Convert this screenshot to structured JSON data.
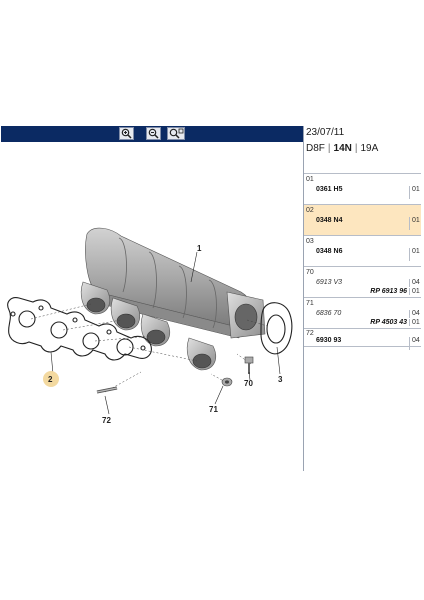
{
  "toolbar": {
    "buttons": [
      {
        "label": "zoom in",
        "icon": "zoom-in-icon"
      },
      {
        "label": "zoom out",
        "icon": "zoom-out-icon"
      },
      {
        "label": "fit",
        "icon": "zoom-fit-icon"
      }
    ]
  },
  "header": {
    "date": "23/07/11",
    "code1": "D8F",
    "code2": "14N",
    "code3": "19A"
  },
  "parts": [
    {
      "index": "01",
      "ref": "0361 H5",
      "qty": "01",
      "selected": false,
      "italic": false
    },
    {
      "index": "02",
      "ref": "0348 N4",
      "qty": "01",
      "selected": true,
      "italic": false
    },
    {
      "index": "03",
      "ref": "0348 N6",
      "qty": "01",
      "selected": false,
      "italic": false
    },
    {
      "index": "70",
      "ref": "6913 V3",
      "replacement": "RP 6913 96",
      "qty": "04",
      "qty2": "01",
      "selected": false,
      "italic": true
    },
    {
      "index": "71",
      "ref": "6836 70",
      "replacement": "RP 4503 43",
      "qty": "04",
      "qty2": "01",
      "selected": false,
      "italic": true
    },
    {
      "index": "72",
      "ref": "6930 93",
      "qty": "04",
      "selected": false,
      "italic": false
    }
  ],
  "callouts": [
    "1",
    "2",
    "3",
    "70",
    "71",
    "72"
  ],
  "colors": {
    "toolbar": "#0b2a63",
    "selected_row": "#fde6bf",
    "callout_circle": "#f3d9a0"
  }
}
